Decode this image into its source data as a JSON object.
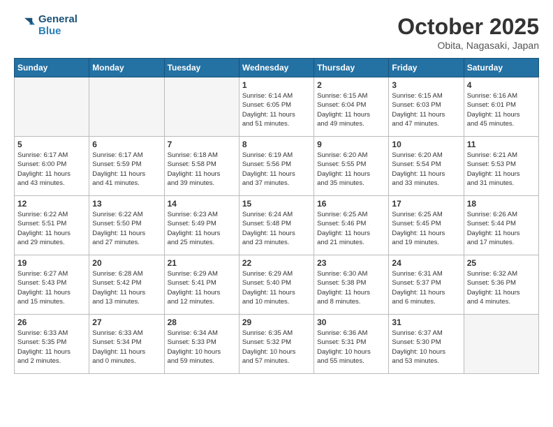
{
  "header": {
    "logo_line1": "General",
    "logo_line2": "Blue",
    "month": "October 2025",
    "location": "Obita, Nagasaki, Japan"
  },
  "days_of_week": [
    "Sunday",
    "Monday",
    "Tuesday",
    "Wednesday",
    "Thursday",
    "Friday",
    "Saturday"
  ],
  "weeks": [
    [
      {
        "num": "",
        "info": ""
      },
      {
        "num": "",
        "info": ""
      },
      {
        "num": "",
        "info": ""
      },
      {
        "num": "1",
        "info": "Sunrise: 6:14 AM\nSunset: 6:05 PM\nDaylight: 11 hours\nand 51 minutes."
      },
      {
        "num": "2",
        "info": "Sunrise: 6:15 AM\nSunset: 6:04 PM\nDaylight: 11 hours\nand 49 minutes."
      },
      {
        "num": "3",
        "info": "Sunrise: 6:15 AM\nSunset: 6:03 PM\nDaylight: 11 hours\nand 47 minutes."
      },
      {
        "num": "4",
        "info": "Sunrise: 6:16 AM\nSunset: 6:01 PM\nDaylight: 11 hours\nand 45 minutes."
      }
    ],
    [
      {
        "num": "5",
        "info": "Sunrise: 6:17 AM\nSunset: 6:00 PM\nDaylight: 11 hours\nand 43 minutes."
      },
      {
        "num": "6",
        "info": "Sunrise: 6:17 AM\nSunset: 5:59 PM\nDaylight: 11 hours\nand 41 minutes."
      },
      {
        "num": "7",
        "info": "Sunrise: 6:18 AM\nSunset: 5:58 PM\nDaylight: 11 hours\nand 39 minutes."
      },
      {
        "num": "8",
        "info": "Sunrise: 6:19 AM\nSunset: 5:56 PM\nDaylight: 11 hours\nand 37 minutes."
      },
      {
        "num": "9",
        "info": "Sunrise: 6:20 AM\nSunset: 5:55 PM\nDaylight: 11 hours\nand 35 minutes."
      },
      {
        "num": "10",
        "info": "Sunrise: 6:20 AM\nSunset: 5:54 PM\nDaylight: 11 hours\nand 33 minutes."
      },
      {
        "num": "11",
        "info": "Sunrise: 6:21 AM\nSunset: 5:53 PM\nDaylight: 11 hours\nand 31 minutes."
      }
    ],
    [
      {
        "num": "12",
        "info": "Sunrise: 6:22 AM\nSunset: 5:51 PM\nDaylight: 11 hours\nand 29 minutes."
      },
      {
        "num": "13",
        "info": "Sunrise: 6:22 AM\nSunset: 5:50 PM\nDaylight: 11 hours\nand 27 minutes."
      },
      {
        "num": "14",
        "info": "Sunrise: 6:23 AM\nSunset: 5:49 PM\nDaylight: 11 hours\nand 25 minutes."
      },
      {
        "num": "15",
        "info": "Sunrise: 6:24 AM\nSunset: 5:48 PM\nDaylight: 11 hours\nand 23 minutes."
      },
      {
        "num": "16",
        "info": "Sunrise: 6:25 AM\nSunset: 5:46 PM\nDaylight: 11 hours\nand 21 minutes."
      },
      {
        "num": "17",
        "info": "Sunrise: 6:25 AM\nSunset: 5:45 PM\nDaylight: 11 hours\nand 19 minutes."
      },
      {
        "num": "18",
        "info": "Sunrise: 6:26 AM\nSunset: 5:44 PM\nDaylight: 11 hours\nand 17 minutes."
      }
    ],
    [
      {
        "num": "19",
        "info": "Sunrise: 6:27 AM\nSunset: 5:43 PM\nDaylight: 11 hours\nand 15 minutes."
      },
      {
        "num": "20",
        "info": "Sunrise: 6:28 AM\nSunset: 5:42 PM\nDaylight: 11 hours\nand 13 minutes."
      },
      {
        "num": "21",
        "info": "Sunrise: 6:29 AM\nSunset: 5:41 PM\nDaylight: 11 hours\nand 12 minutes."
      },
      {
        "num": "22",
        "info": "Sunrise: 6:29 AM\nSunset: 5:40 PM\nDaylight: 11 hours\nand 10 minutes."
      },
      {
        "num": "23",
        "info": "Sunrise: 6:30 AM\nSunset: 5:38 PM\nDaylight: 11 hours\nand 8 minutes."
      },
      {
        "num": "24",
        "info": "Sunrise: 6:31 AM\nSunset: 5:37 PM\nDaylight: 11 hours\nand 6 minutes."
      },
      {
        "num": "25",
        "info": "Sunrise: 6:32 AM\nSunset: 5:36 PM\nDaylight: 11 hours\nand 4 minutes."
      }
    ],
    [
      {
        "num": "26",
        "info": "Sunrise: 6:33 AM\nSunset: 5:35 PM\nDaylight: 11 hours\nand 2 minutes."
      },
      {
        "num": "27",
        "info": "Sunrise: 6:33 AM\nSunset: 5:34 PM\nDaylight: 11 hours\nand 0 minutes."
      },
      {
        "num": "28",
        "info": "Sunrise: 6:34 AM\nSunset: 5:33 PM\nDaylight: 10 hours\nand 59 minutes."
      },
      {
        "num": "29",
        "info": "Sunrise: 6:35 AM\nSunset: 5:32 PM\nDaylight: 10 hours\nand 57 minutes."
      },
      {
        "num": "30",
        "info": "Sunrise: 6:36 AM\nSunset: 5:31 PM\nDaylight: 10 hours\nand 55 minutes."
      },
      {
        "num": "31",
        "info": "Sunrise: 6:37 AM\nSunset: 5:30 PM\nDaylight: 10 hours\nand 53 minutes."
      },
      {
        "num": "",
        "info": ""
      }
    ]
  ]
}
